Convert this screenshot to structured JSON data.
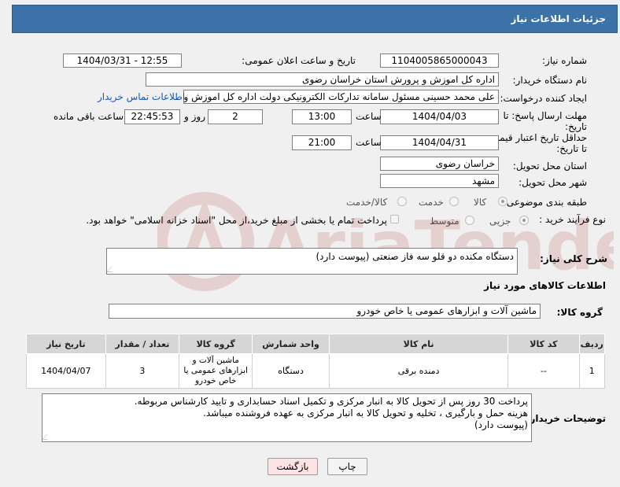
{
  "header": {
    "title": "جزئیات اطلاعات نیاز"
  },
  "form": {
    "need_number": {
      "label": "شماره نیاز:",
      "value": "1104005865000043"
    },
    "announce": {
      "label": "تاریخ و ساعت اعلان عمومی:",
      "value": "1404/03/31 - 12:55"
    },
    "buyer_org": {
      "label": "نام دستگاه خریدار:",
      "value": "اداره کل اموزش و پرورش استان خراسان رضوی"
    },
    "requester": {
      "label": "ایجاد کننده درخواست:",
      "value": "علی محمد حسینی مسئول سامانه تدارکات الکترونیکی دولت اداره کل اموزش و",
      "contact_link": "اطلاعات تماس خریدار"
    },
    "deadline": {
      "label_line1": "مهلت ارسال پاسخ: تا",
      "label_line2": "تاریخ:",
      "date": "1404/04/03",
      "time_label": "ساعت",
      "time": "13:00",
      "days": "2",
      "days_label": "روز و",
      "remaining": "22:45:53",
      "remaining_label": "ساعت باقی مانده"
    },
    "price_validity": {
      "label_line1": "حداقل تاریخ اعتبار قیمت:",
      "label_line2": "تا تاریخ:",
      "date": "1404/04/31",
      "time_label": "ساعت",
      "time": "21:00"
    },
    "delivery_province": {
      "label": "استان محل تحویل:",
      "value": "خراسان رضوی"
    },
    "delivery_city": {
      "label": "شهر محل تحویل:",
      "value": "مشهد"
    },
    "category": {
      "label": "طبقه بندی موضوعی:",
      "options": [
        "کالا",
        "خدمت",
        "کالا/خدمت"
      ],
      "selected": "کالا"
    },
    "process": {
      "label": "نوع فرآیند خرید :",
      "options": [
        "جزیی",
        "متوسط"
      ],
      "selected": "جزیی",
      "note": "پرداخت تمام یا بخشی از مبلغ خرید،از محل \"اسناد خزانه اسلامی\" خواهد بود."
    }
  },
  "description": {
    "label": "شرح کلی نیاز:",
    "value": "دستگاه مکنده دو قلو سه فاز صنعتی (پیوست دارد)"
  },
  "goods_section": {
    "title": "اطلاعات کالاهای مورد نیاز",
    "group_label": "گروه کالا:",
    "group_value": "ماشین آلات و ابزارهای عمومی یا خاص خودرو"
  },
  "table": {
    "headers": [
      "ردیف",
      "کد کالا",
      "نام کالا",
      "واحد شمارش",
      "گروه کالا",
      "تعداد / مقدار",
      "تاریخ نیاز"
    ],
    "rows": [
      {
        "row": "1",
        "code": "--",
        "name": "دمنده برقی",
        "unit": "دستگاه",
        "group": "ماشین آلات و ابزارهای عمومی یا خاص خودرو",
        "qty": "3",
        "date": "1404/04/07"
      }
    ]
  },
  "buyer_notes": {
    "label": "توضیحات خریدار:",
    "lines": [
      "پرداخت 30 روز پس از تحویل کالا به انبار مرکزی و تکمیل اسناد حسابداری و تایید کارشناس مربوطه.",
      "هزینه حمل و بارگیری ، تخلیه و تحویل کالا به انبار مرکزی به عهده فروشنده میباشد.",
      "(پیوست دارد)"
    ]
  },
  "buttons": {
    "print": "چاپ",
    "back": "بازگشت"
  },
  "colors": {
    "header": "#3b72a8",
    "link": "#1a56b0",
    "back_button": "#fde3e3"
  }
}
